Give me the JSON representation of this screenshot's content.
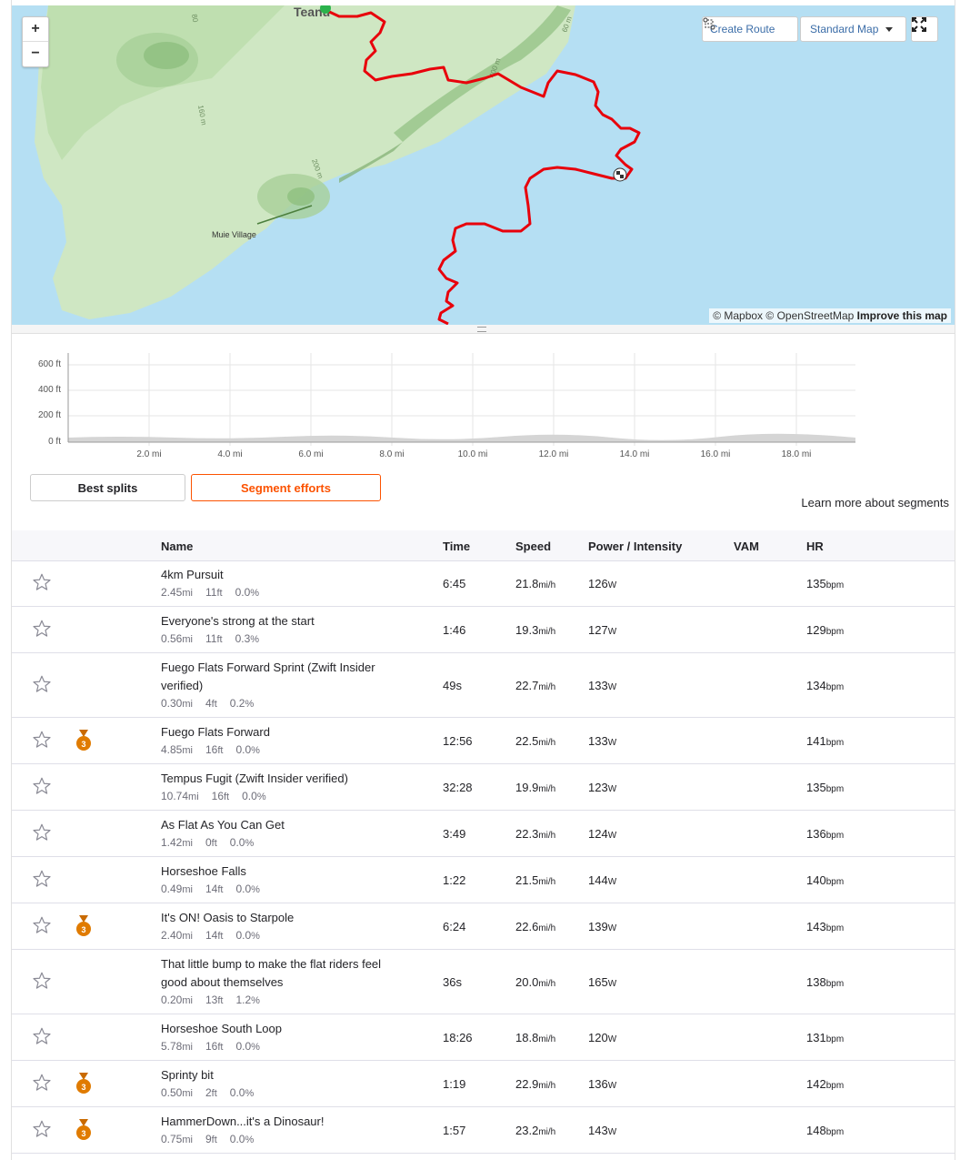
{
  "map": {
    "zoom_in": "+",
    "zoom_out": "−",
    "create_route": "Create Route",
    "map_style": "Standard Map",
    "fullscreen_icon": "expand-icon",
    "labels": {
      "village": "Muie Village",
      "top": "Teanu",
      "contour_160": "160 m",
      "contour_200": "200 m",
      "contour_400": "400 m",
      "contour_80": "80",
      "contour_60": "60 m"
    },
    "attribution": {
      "mapbox": "© Mapbox",
      "osm": "© OpenStreetMap",
      "improve": "Improve this map"
    },
    "colors": {
      "water": "#b5dff3",
      "land": "#cfe7c3",
      "route": "#e8000b"
    }
  },
  "elevation": {
    "y_labels": [
      "600 ft",
      "400 ft",
      "200 ft",
      "0 ft"
    ],
    "x_labels": [
      "2.0 mi",
      "4.0 mi",
      "6.0 mi",
      "8.0 mi",
      "10.0 mi",
      "12.0 mi",
      "14.0 mi",
      "16.0 mi",
      "18.0 mi"
    ]
  },
  "tabs": {
    "best_splits": "Best splits",
    "segment_efforts": "Segment efforts"
  },
  "learn_more": "Learn more about segments",
  "table": {
    "headers": {
      "name": "Name",
      "time": "Time",
      "speed": "Speed",
      "power": "Power / Intensity",
      "vam": "VAM",
      "hr": "HR"
    },
    "units": {
      "dist": "mi",
      "elev": "ft",
      "grade": "%",
      "speed": "mi/h",
      "power": "W",
      "hr": "bpm"
    },
    "rows": [
      {
        "name": "4km Pursuit",
        "dist": "2.45",
        "elev": "11",
        "grade": "0.0",
        "time": "6:45",
        "speed": "21.8",
        "power": "126",
        "hr": "135",
        "medal": ""
      },
      {
        "name": "Everyone's strong at the start",
        "dist": "0.56",
        "elev": "11",
        "grade": "0.3",
        "time": "1:46",
        "speed": "19.3",
        "power": "127",
        "hr": "129",
        "medal": ""
      },
      {
        "name": "Fuego Flats Forward Sprint (Zwift Insider verified)",
        "dist": "0.30",
        "elev": "4",
        "grade": "0.2",
        "time": "49s",
        "speed": "22.7",
        "power": "133",
        "hr": "134",
        "medal": ""
      },
      {
        "name": "Fuego Flats Forward",
        "dist": "4.85",
        "elev": "16",
        "grade": "0.0",
        "time": "12:56",
        "speed": "22.5",
        "power": "133",
        "hr": "141",
        "medal": "3"
      },
      {
        "name": "Tempus Fugit (Zwift Insider verified)",
        "dist": "10.74",
        "elev": "16",
        "grade": "0.0",
        "time": "32:28",
        "speed": "19.9",
        "power": "123",
        "hr": "135",
        "medal": ""
      },
      {
        "name": "As Flat As You Can Get",
        "dist": "1.42",
        "elev": "0",
        "grade": "0.0",
        "time": "3:49",
        "speed": "22.3",
        "power": "124",
        "hr": "136",
        "medal": ""
      },
      {
        "name": "Horseshoe Falls",
        "dist": "0.49",
        "elev": "14",
        "grade": "0.0",
        "time": "1:22",
        "speed": "21.5",
        "power": "144",
        "hr": "140",
        "medal": ""
      },
      {
        "name": "It's ON! Oasis to Starpole",
        "dist": "2.40",
        "elev": "14",
        "grade": "0.0",
        "time": "6:24",
        "speed": "22.6",
        "power": "139",
        "hr": "143",
        "medal": "3"
      },
      {
        "name": "That little bump to make the flat riders feel good about themselves",
        "dist": "0.20",
        "elev": "13",
        "grade": "1.2",
        "time": "36s",
        "speed": "20.0",
        "power": "165",
        "hr": "138",
        "medal": ""
      },
      {
        "name": "Horseshoe South Loop",
        "dist": "5.78",
        "elev": "16",
        "grade": "0.0",
        "time": "18:26",
        "speed": "18.8",
        "power": "120",
        "hr": "131",
        "medal": ""
      },
      {
        "name": "Sprinty bit",
        "dist": "0.50",
        "elev": "2",
        "grade": "0.0",
        "time": "1:19",
        "speed": "22.9",
        "power": "136",
        "hr": "142",
        "medal": "3"
      },
      {
        "name": "HammerDown...it's a Dinosaur!",
        "dist": "0.75",
        "elev": "9",
        "grade": "0.0",
        "time": "1:57",
        "speed": "23.2",
        "power": "143",
        "hr": "148",
        "medal": "3"
      }
    ]
  }
}
